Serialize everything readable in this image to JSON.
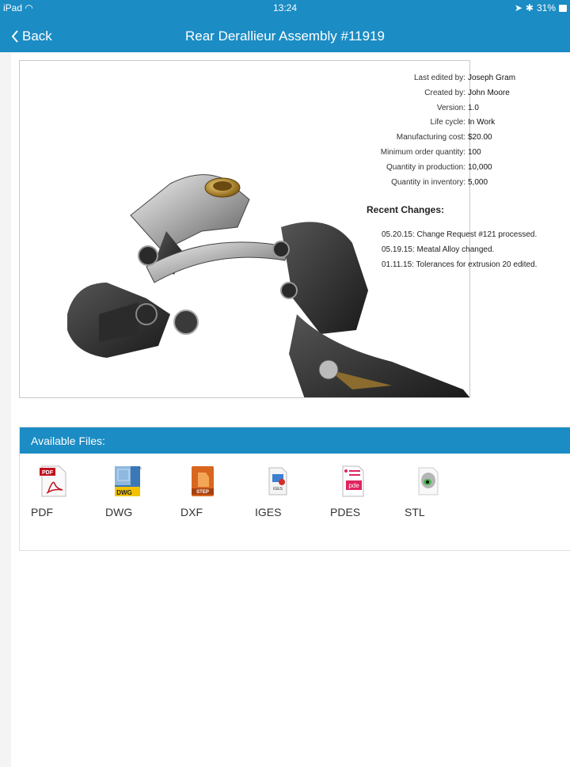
{
  "status": {
    "device": "iPad",
    "wifi_icon": "wifi-icon",
    "time": "13:24",
    "battery": "31%"
  },
  "nav": {
    "back_label": "Back",
    "title": "Rear Derallieur Assembly #11919"
  },
  "meta": [
    {
      "label": "Last edited by:",
      "value": "Joseph Gram"
    },
    {
      "label": "Created by:",
      "value": "John Moore"
    },
    {
      "label": "Version:",
      "value": "1.0"
    },
    {
      "label": "Life cycle:",
      "value": "In Work"
    },
    {
      "label": "Manufacturing cost:",
      "value": "$20.00"
    },
    {
      "label": "Minimum order quantity:",
      "value": "100"
    },
    {
      "label": "Quantity in production:",
      "value": "10,000"
    },
    {
      "label": "Quantity in inventory:",
      "value": "5,000"
    }
  ],
  "recent": {
    "title": "Recent Changes:",
    "items": [
      "05.20.15: Change Request #121 processed.",
      "05.19.15: Meatal Alloy changed.",
      "01.11.15: Tolerances for extrusion 20 edited."
    ]
  },
  "files": {
    "header": "Available Files:",
    "items": [
      {
        "label": "PDF",
        "icon": "pdf-file-icon",
        "badge": "PDF"
      },
      {
        "label": "DWG",
        "icon": "dwg-file-icon",
        "badge": "DWG"
      },
      {
        "label": "DXF",
        "icon": "dxf-file-icon",
        "badge": "STEP"
      },
      {
        "label": "IGES",
        "icon": "iges-file-icon",
        "badge": "IGES"
      },
      {
        "label": "PDES",
        "icon": "pdes-file-icon",
        "badge": "pde"
      },
      {
        "label": "STL",
        "icon": "stl-file-icon",
        "badge": ""
      }
    ]
  },
  "colors": {
    "accent": "#1b8cc4"
  }
}
